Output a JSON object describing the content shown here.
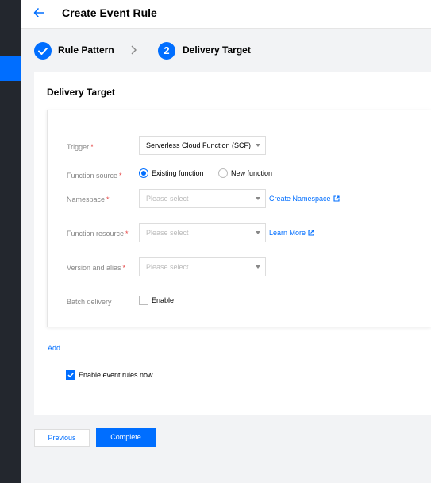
{
  "page": {
    "title": "Create Event Rule"
  },
  "steps": [
    {
      "label": "Rule Pattern",
      "state": "done"
    },
    {
      "number": "2",
      "label": "Delivery Target",
      "state": "active"
    }
  ],
  "card": {
    "title": "Delivery Target"
  },
  "form": {
    "trigger": {
      "label": "Trigger",
      "required": "*",
      "value": "Serverless Cloud Function (SCF)"
    },
    "function_source": {
      "label": "Function source",
      "required": "*",
      "options": [
        "Existing function",
        "New function"
      ],
      "selected": "Existing function"
    },
    "namespace": {
      "label": "Namespace",
      "required": "*",
      "placeholder": "Please select",
      "link": "Create Namespace"
    },
    "function_resource": {
      "label": "Function resource",
      "required": "*",
      "placeholder": "Please select",
      "link": "Learn More"
    },
    "version_alias": {
      "label": "Version and alias",
      "required": "*",
      "placeholder": "Please select"
    },
    "batch_delivery": {
      "label": "Batch delivery",
      "checkbox_label": "Enable",
      "checked": false
    }
  },
  "add_label": "Add",
  "enable_now": {
    "label": "Enable event rules now",
    "checked": true
  },
  "buttons": {
    "previous": "Previous",
    "complete": "Complete"
  },
  "colors": {
    "accent": "#006eff",
    "sidebar": "#23272e",
    "required": "#e54545"
  }
}
